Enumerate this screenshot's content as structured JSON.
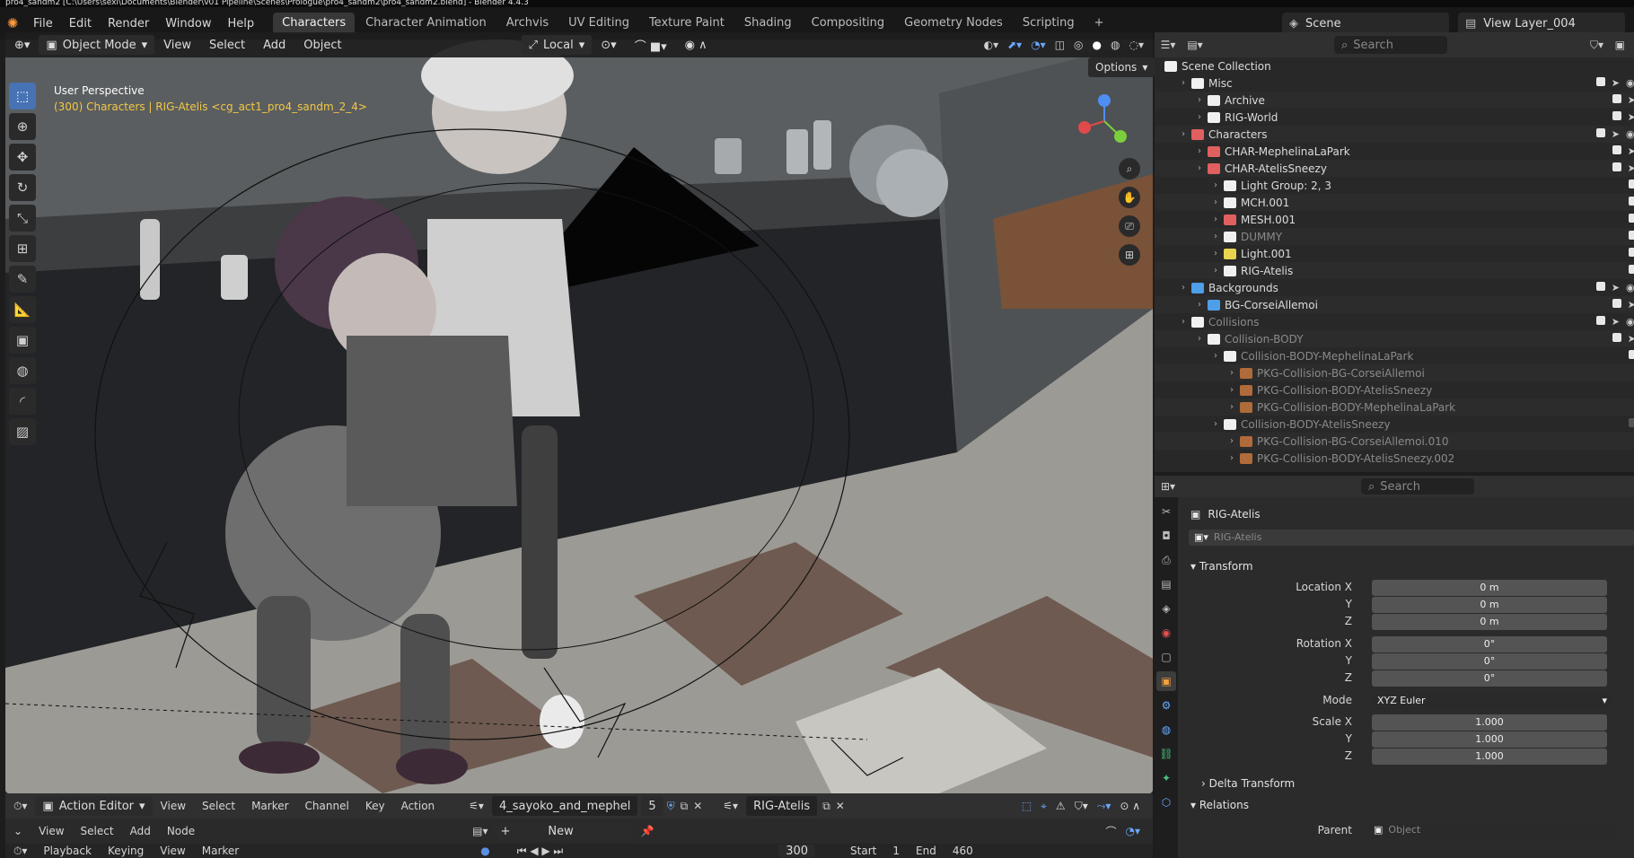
{
  "titlebar": "pro4_sandm2 [C:\\Users\\sexi\\Documents\\Blender\\v01 Pipeline\\Scenes\\Prologue\\pro4_sandm2\\pro4_sandm2.blend] - Blender 4.4.3",
  "menu": [
    "File",
    "Edit",
    "Render",
    "Window",
    "Help"
  ],
  "workspaces": [
    "Characters",
    "Character Animation",
    "Archvis",
    "UV Editing",
    "Texture Paint",
    "Shading",
    "Compositing",
    "Geometry Nodes",
    "Scripting"
  ],
  "active_workspace": "Characters",
  "scene": "Scene",
  "view_layer": "View Layer_004",
  "viewport": {
    "mode": "Object Mode",
    "menus": [
      "View",
      "Select",
      "Add",
      "Object"
    ],
    "orientation": "Local",
    "options": "Options",
    "info_line1": "User Perspective",
    "info_line2": "(300) Characters | RIG-Atelis <cg_act1_pro4_sandm_2_4>"
  },
  "outliner": {
    "search_placeholder": "Search",
    "root": "Scene Collection",
    "rows": [
      {
        "label": "Misc",
        "depth": 1
      },
      {
        "label": "Archive",
        "depth": 2
      },
      {
        "label": "RIG-World",
        "depth": 2
      },
      {
        "label": "Characters",
        "depth": 1
      },
      {
        "label": "CHAR-MephelinaLaPark",
        "depth": 2
      },
      {
        "label": "CHAR-AtelisSneezy",
        "depth": 2
      },
      {
        "label": "Light Group: 2, 3",
        "depth": 3
      },
      {
        "label": "MCH.001",
        "depth": 3
      },
      {
        "label": "MESH.001",
        "depth": 3
      },
      {
        "label": "DUMMY",
        "depth": 3
      },
      {
        "label": "Light.001",
        "depth": 3
      },
      {
        "label": "RIG-Atelis",
        "depth": 3
      },
      {
        "label": "Backgrounds",
        "depth": 1
      },
      {
        "label": "BG-CorseiAllemoi",
        "depth": 2
      },
      {
        "label": "Collisions",
        "depth": 1
      },
      {
        "label": "Collision-BODY",
        "depth": 2
      },
      {
        "label": "Collision-BODY-MephelinaLaPark",
        "depth": 3
      },
      {
        "label": "PKG-Collision-BG-CorseiAllemoi",
        "depth": 4
      },
      {
        "label": "PKG-Collision-BODY-AtelisSneezy",
        "depth": 4
      },
      {
        "label": "PKG-Collision-BODY-MephelinaLaPark",
        "depth": 4
      },
      {
        "label": "Collision-BODY-AtelisSneezy",
        "depth": 3
      },
      {
        "label": "PKG-Collision-BG-CorseiAllemoi.010",
        "depth": 4
      },
      {
        "label": "PKG-Collision-BODY-AtelisSneezy.002",
        "depth": 4
      }
    ]
  },
  "properties": {
    "search_placeholder": "Search",
    "object_name": "RIG-Atelis",
    "object_field": "RIG-Atelis",
    "transform": "Transform",
    "location_x_label": "Location X",
    "y_label": "Y",
    "z_label": "Z",
    "location": [
      "0 m",
      "0 m",
      "0 m"
    ],
    "rotation_x_label": "Rotation X",
    "rotation": [
      "0°",
      "0°",
      "0°"
    ],
    "mode_label": "Mode",
    "mode_value": "XYZ Euler",
    "scale_x_label": "Scale X",
    "scale": [
      "1.000",
      "1.000",
      "1.000"
    ],
    "delta_transform": "Delta Transform",
    "relations": "Relations",
    "parent_label": "Parent",
    "parent_placeholder": "Object"
  },
  "action_editor": {
    "editor": "Action Editor",
    "menus": [
      "View",
      "Select",
      "Marker",
      "Channel",
      "Key",
      "Action"
    ],
    "action_name": "4_sayoko_and_mephel",
    "users": "5",
    "object": "RIG-Atelis"
  },
  "node_editor": {
    "menus": [
      "View",
      "Select",
      "Add",
      "Node"
    ],
    "new_label": "New"
  },
  "timeline": {
    "menus": [
      "Playback",
      "Keying",
      "View",
      "Marker"
    ],
    "current_frame": "300",
    "start_label": "Start",
    "start": "1",
    "end_label": "End",
    "end": "460"
  }
}
